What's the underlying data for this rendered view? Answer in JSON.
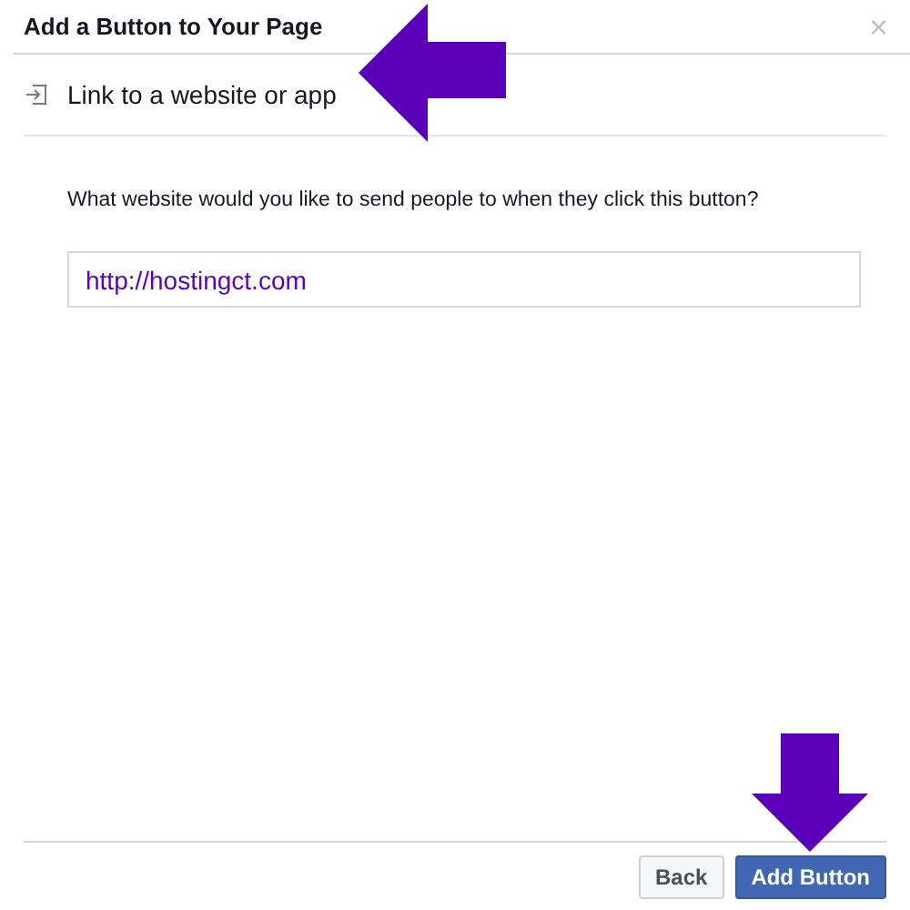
{
  "dialog": {
    "title": "Add a Button to Your Page",
    "close": "×"
  },
  "option": {
    "label": "Link to a website or app"
  },
  "question": "What website would you like to send people to when they click this button?",
  "url_field": {
    "value": "http://hostingct.com"
  },
  "buttons": [
    {
      "label": "Back",
      "kind": "secondary"
    },
    {
      "label": "Add Button",
      "kind": "primary"
    }
  ],
  "annotations": [
    {
      "kind": "left"
    },
    {
      "kind": "down"
    }
  ]
}
